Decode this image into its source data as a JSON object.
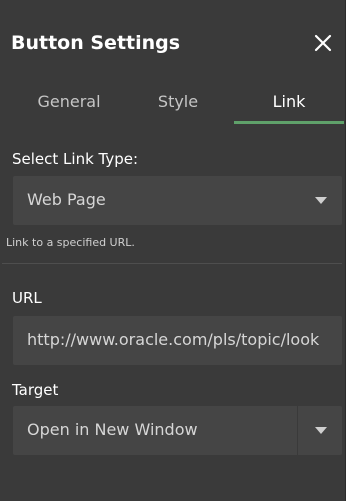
{
  "dialog": {
    "title": "Button Settings",
    "close_icon": "close-icon"
  },
  "tabs": [
    {
      "label": "General",
      "active": false
    },
    {
      "label": "Style",
      "active": false
    },
    {
      "label": "Link",
      "active": true
    }
  ],
  "link_type": {
    "label": "Select Link Type:",
    "value": "Web Page",
    "hint": "Link to a specified URL.",
    "icon": "chevron-down-icon"
  },
  "url": {
    "label": "URL",
    "value": "http://www.oracle.com/pls/topic/look"
  },
  "target": {
    "label": "Target",
    "value": "Open in New Window",
    "icon": "chevron-down-icon"
  },
  "colors": {
    "panel_bg": "#3a3a3a",
    "field_bg": "#454545",
    "active_tab_underline": "#5fa16a"
  }
}
